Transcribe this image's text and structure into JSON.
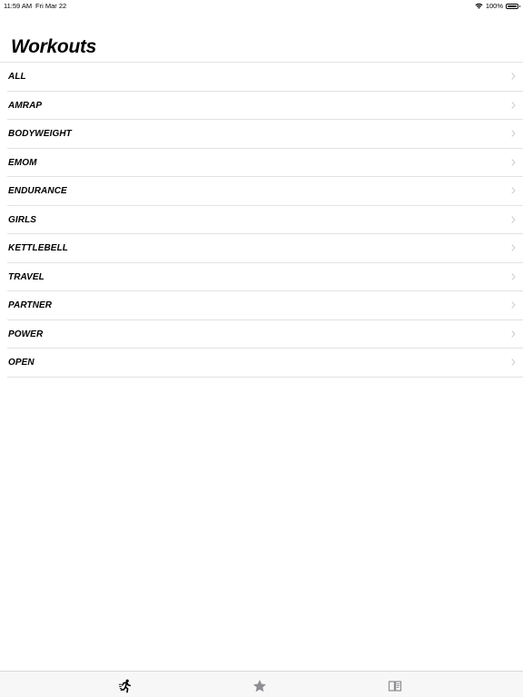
{
  "status_bar": {
    "time": "11:59 AM",
    "date": "Fri Mar 22",
    "battery": "100%",
    "battery_level": 1.0
  },
  "header": {
    "title": "Workouts"
  },
  "workouts": {
    "items": [
      {
        "label": "ALL"
      },
      {
        "label": "AMRAP"
      },
      {
        "label": "BODYWEIGHT"
      },
      {
        "label": "EMOM"
      },
      {
        "label": "ENDURANCE"
      },
      {
        "label": "GIRLS"
      },
      {
        "label": "KETTLEBELL"
      },
      {
        "label": "TRAVEL"
      },
      {
        "label": "PARTNER"
      },
      {
        "label": "POWER"
      },
      {
        "label": "OPEN"
      }
    ]
  },
  "tab_bar": {
    "tabs": [
      {
        "icon": "running-figure-icon",
        "selected": true
      },
      {
        "icon": "star-icon",
        "selected": false
      },
      {
        "icon": "book-icon",
        "selected": false
      }
    ]
  },
  "colors": {
    "text": "#000000",
    "separator": "#e2e2e2",
    "chevron": "#c4c4c7",
    "tab_bar_background": "#f7f7f7",
    "tab_selected": "#000000",
    "tab_unselected": "#8e8e93"
  }
}
